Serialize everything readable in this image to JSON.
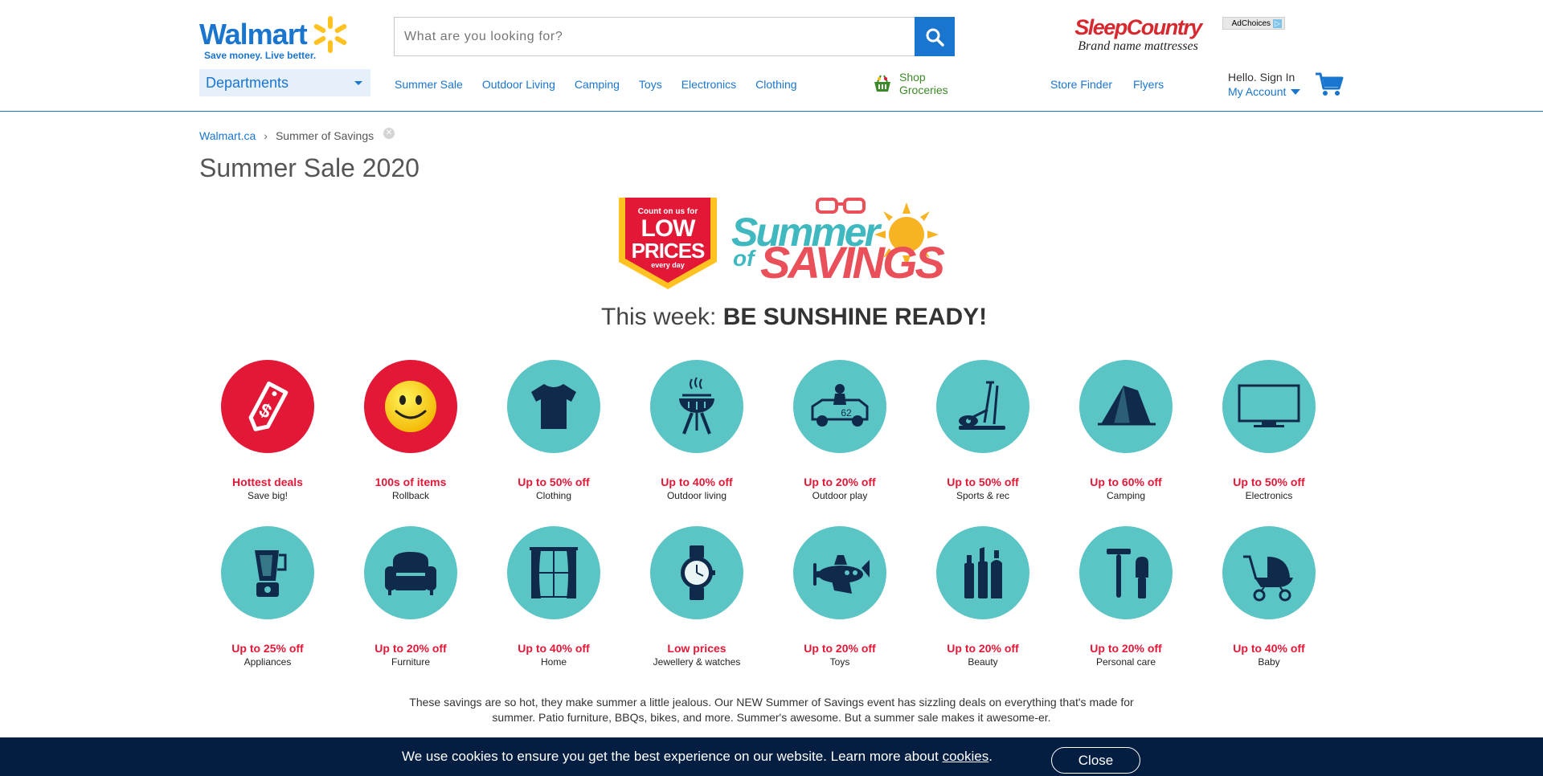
{
  "header": {
    "logo": {
      "word": "Walmart",
      "tagline": "Save money. Live better."
    },
    "search": {
      "placeholder": "What are you looking for?",
      "value": ""
    },
    "ad": {
      "brand": "SleepCountry",
      "subtitle": "Brand name mattresses",
      "adchoices": "AdChoices"
    },
    "departments": "Departments",
    "nav": [
      "Summer Sale",
      "Outdoor Living",
      "Camping",
      "Toys",
      "Electronics",
      "Clothing"
    ],
    "groceries": {
      "line1": "Shop",
      "line2": "Groceries"
    },
    "store_finder": "Store Finder",
    "flyers": "Flyers",
    "account": {
      "hello": "Hello. Sign In",
      "my_account": "My Account"
    }
  },
  "breadcrumb": {
    "home": "Walmart.ca",
    "separator": "›",
    "current": "Summer of Savings"
  },
  "page_title": "Summer Sale 2020",
  "banner": {
    "badge": {
      "line1": "Count on us for",
      "line2": "LOW",
      "line3": "PRICES",
      "line4": "every day"
    },
    "title_line1": "Summer",
    "title_of": "of",
    "title_line2": "SAVINGS"
  },
  "week": {
    "prefix": "This week:",
    "headline": "BE SUNSHINE READY!"
  },
  "categories_row1": [
    {
      "deal": "Hottest deals",
      "label": "Save big!",
      "icon": "price-tag-icon",
      "color": "#e31837"
    },
    {
      "deal": "100s of items",
      "label": "Rollback",
      "icon": "smiley-icon",
      "color": "#e31837"
    },
    {
      "deal": "Up to 50% off",
      "label": "Clothing",
      "icon": "tshirt-icon",
      "color": "#5bc4c4"
    },
    {
      "deal": "Up to 40% off",
      "label": "Outdoor living",
      "icon": "bbq-grill-icon",
      "color": "#5bc4c4"
    },
    {
      "deal": "Up to 20% off",
      "label": "Outdoor play",
      "icon": "ride-on-car-icon",
      "color": "#5bc4c4"
    },
    {
      "deal": "Up to 50% off",
      "label": "Sports & rec",
      "icon": "elliptical-icon",
      "color": "#5bc4c4"
    },
    {
      "deal": "Up to 60% off",
      "label": "Camping",
      "icon": "tent-icon",
      "color": "#5bc4c4"
    },
    {
      "deal": "Up to 50% off",
      "label": "Electronics",
      "icon": "tv-icon",
      "color": "#5bc4c4"
    }
  ],
  "categories_row2": [
    {
      "deal": "Up to 25% off",
      "label": "Appliances",
      "icon": "blender-icon"
    },
    {
      "deal": "Up to 20% off",
      "label": "Furniture",
      "icon": "armchair-icon"
    },
    {
      "deal": "Up to 40% off",
      "label": "Home",
      "icon": "curtains-icon"
    },
    {
      "deal": "Low prices",
      "label": "Jewellery & watches",
      "icon": "watch-icon"
    },
    {
      "deal": "Up to 20% off",
      "label": "Toys",
      "icon": "toy-plane-icon"
    },
    {
      "deal": "Up to 20% off",
      "label": "Beauty",
      "icon": "beauty-products-icon"
    },
    {
      "deal": "Up to 20% off",
      "label": "Personal care",
      "icon": "razor-icon"
    },
    {
      "deal": "Up to 40% off",
      "label": "Baby",
      "icon": "stroller-icon"
    }
  ],
  "ride_on_car_number": "62",
  "blurb": "These savings are so hot, they make summer a little jealous. Our NEW Summer of Savings event has sizzling deals on everything that's made for summer. Patio furniture, BBQs, bikes, and more. Summer's awesome. But a summer sale makes it awesome-er.",
  "cookie": {
    "text": "We use cookies to ensure you get the best experience on our website. Learn more about",
    "link": "cookies",
    "period": ".",
    "close": "Close"
  },
  "colors": {
    "brand_blue": "#1a75cf",
    "deal_red": "#e31837",
    "teal": "#5bc4c4",
    "cookie_navy": "#041e42",
    "grocery_green": "#3c8a27"
  }
}
